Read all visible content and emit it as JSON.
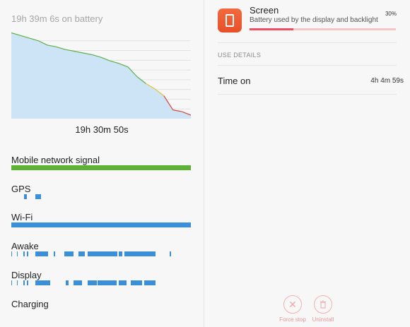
{
  "battery": {
    "summary": "19h 39m 6s on battery",
    "duration": "19h 30m 50s",
    "chart_data": {
      "type": "area",
      "x": [
        0,
        0.05,
        0.1,
        0.15,
        0.2,
        0.25,
        0.3,
        0.35,
        0.4,
        0.45,
        0.5,
        0.55,
        0.6,
        0.65,
        0.7,
        0.75,
        0.8,
        0.85,
        0.9,
        0.95,
        1.0
      ],
      "values": [
        98,
        95,
        92,
        89,
        84,
        82,
        79,
        77,
        75,
        73,
        70,
        66,
        63,
        59,
        48,
        40,
        34,
        26,
        10,
        8,
        4
      ],
      "ylim": [
        0,
        100
      ],
      "colors": {
        "fill": "#cde4f6",
        "line_high": "#5bb148",
        "line_mid": "#e5c233",
        "line_low": "#d9453b"
      }
    }
  },
  "tracks": [
    {
      "label": "Mobile network signal",
      "color": "#5bb235",
      "segments": [
        [
          0,
          1
        ]
      ]
    },
    {
      "label": "GPS",
      "color": "#3b8ed8",
      "segments": [
        [
          0.07,
          0.085
        ],
        [
          0.135,
          0.165
        ]
      ]
    },
    {
      "label": "Wi-Fi",
      "color": "#3b8ed8",
      "segments": [
        [
          0,
          1
        ]
      ]
    },
    {
      "label": "Awake",
      "color": "#3b8ed8",
      "segments": [
        [
          0,
          0.005
        ],
        [
          0.03,
          0.035
        ],
        [
          0.065,
          0.075
        ],
        [
          0.085,
          0.095
        ],
        [
          0.135,
          0.205
        ],
        [
          0.235,
          0.245
        ],
        [
          0.295,
          0.345
        ],
        [
          0.375,
          0.41
        ],
        [
          0.425,
          0.475
        ],
        [
          0.475,
          0.59
        ],
        [
          0.6,
          0.62
        ],
        [
          0.63,
          0.665
        ],
        [
          0.665,
          0.805
        ],
        [
          0.88,
          0.89
        ]
      ]
    },
    {
      "label": "Display",
      "color": "#3b8ed8",
      "segments": [
        [
          0,
          0.005
        ],
        [
          0.03,
          0.035
        ],
        [
          0.065,
          0.075
        ],
        [
          0.085,
          0.095
        ],
        [
          0.135,
          0.215
        ],
        [
          0.305,
          0.32
        ],
        [
          0.345,
          0.395
        ],
        [
          0.425,
          0.475
        ],
        [
          0.48,
          0.585
        ],
        [
          0.6,
          0.64
        ],
        [
          0.665,
          0.73
        ],
        [
          0.74,
          0.805
        ]
      ]
    },
    {
      "label": "Charging",
      "color": "#3b8ed8",
      "segments": []
    }
  ],
  "app": {
    "name": "Screen",
    "description": "Battery used by the display and backlight",
    "percent_text": "30%",
    "percent_value": 0.3,
    "icon": "phone-screen-icon"
  },
  "details": {
    "header": "USE DETAILS",
    "rows": [
      {
        "label": "Time on",
        "value": "4h 4m 59s"
      }
    ]
  },
  "actions": [
    {
      "label": "Force stop",
      "icon": "close-icon"
    },
    {
      "label": "Uninstall",
      "icon": "trash-icon"
    }
  ]
}
